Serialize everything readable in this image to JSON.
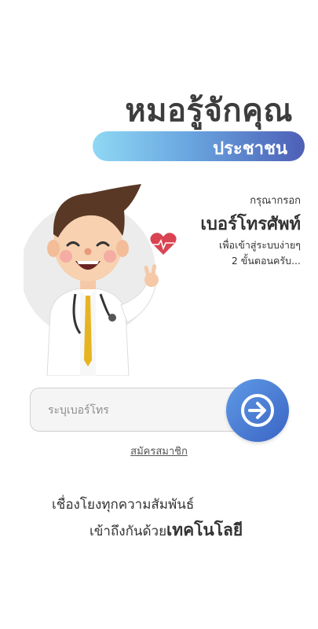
{
  "header": {
    "title": "หมอรู้จักคุณ",
    "subtitle": "ประชาชน"
  },
  "intro": {
    "line1": "กรุณากรอก",
    "line2": "เบอร์โทรศัพท์",
    "line3": "เพื่อเข้าสู่ระบบง่ายๆ",
    "line4": "2 ขั้นตอนครับ..."
  },
  "login": {
    "phone_placeholder": "ระบุเบอร์โทร",
    "phone_value": "",
    "submit_icon": "arrow-right-circle-icon",
    "register_label": "สมัครสมาชิก"
  },
  "tagline": {
    "line1": "เชื่องโยงทุกความสัมพันธ์",
    "line2_prefix": "เข้าถึงกันด้วย",
    "line2_emphasis": "เทคโนโลยี"
  },
  "colors": {
    "accent_blue": "#3a64c4",
    "pill_start": "#8fd8f4",
    "pill_end": "#4d5fb6",
    "heart": "#d94452"
  }
}
